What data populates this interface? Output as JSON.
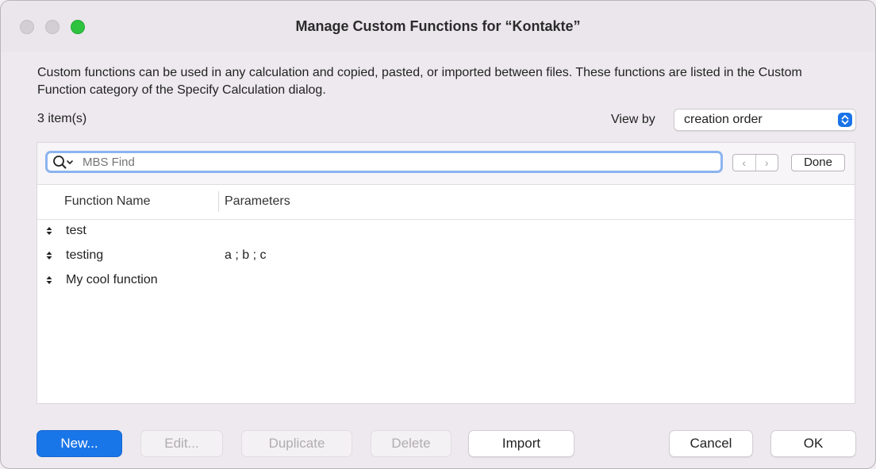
{
  "window": {
    "title": "Manage Custom Functions for “Kontakte”"
  },
  "description": "Custom functions can be used in any calculation and copied, pasted, or imported between files. These functions are listed in the Custom Function category of the Specify Calculation dialog.",
  "item_count": "3 item(s)",
  "view_by": {
    "label": "View by",
    "value": "creation order"
  },
  "find_bar": {
    "placeholder": "MBS Find",
    "prev_label": "‹",
    "next_label": "›",
    "done_label": "Done"
  },
  "columns": {
    "name": "Function Name",
    "params": "Parameters"
  },
  "functions": [
    {
      "name": "test",
      "params": ""
    },
    {
      "name": "testing",
      "params": "a ; b ; c"
    },
    {
      "name": "My cool function",
      "params": ""
    }
  ],
  "buttons": {
    "new": "New...",
    "edit": "Edit...",
    "duplicate": "Duplicate",
    "delete": "Delete",
    "import": "Import",
    "cancel": "Cancel",
    "ok": "OK"
  },
  "colors": {
    "accent": "#1976e8",
    "zoom_button": "#2ec33f",
    "focus_ring": "#8cb3f0"
  },
  "icons": {
    "search": "search-icon",
    "row_handle": "reorder-handle-icon",
    "select_stepper": "chevron-up-down-icon"
  }
}
